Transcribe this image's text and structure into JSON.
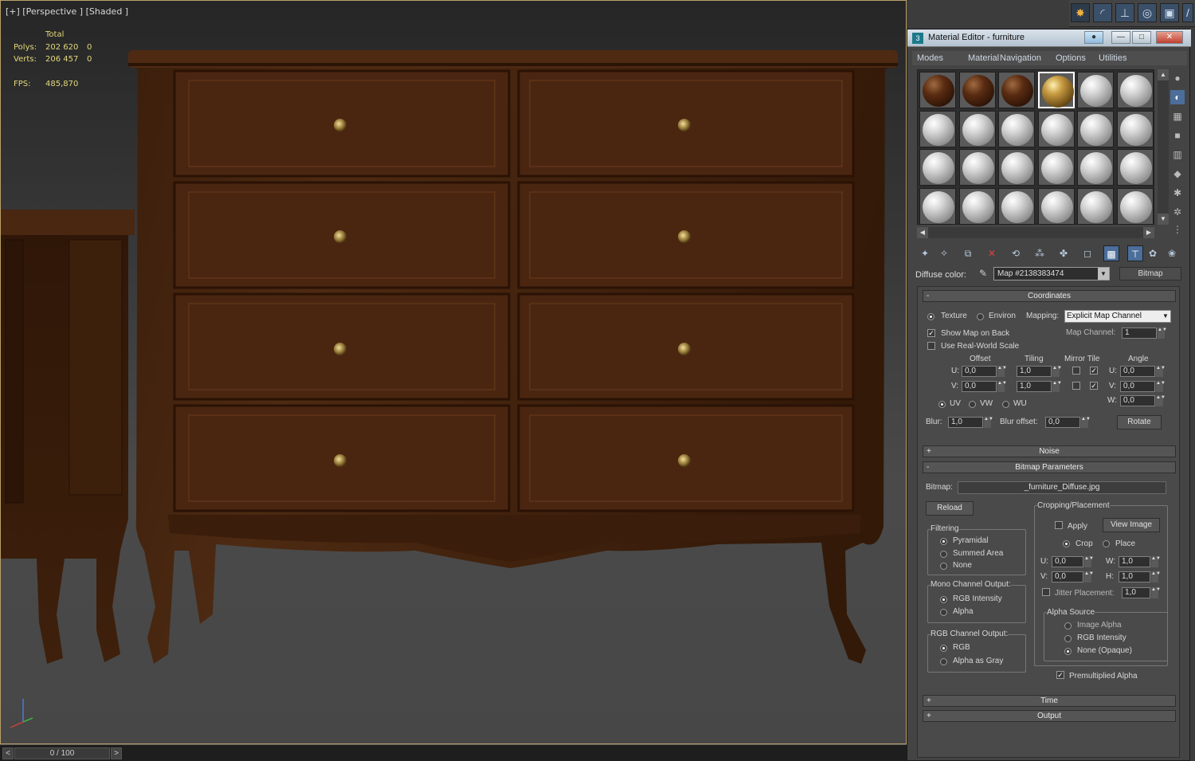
{
  "viewport": {
    "label": "[+] [Perspective ] [Shaded ]",
    "stats": {
      "total_label": "Total",
      "polys_label": "Polys:",
      "polys_value": "202 620",
      "polys_sel": "0",
      "verts_label": "Verts:",
      "verts_value": "206 457",
      "verts_sel": "0",
      "fps_label": "FPS:",
      "fps_value": "485,870"
    }
  },
  "timeline": {
    "frame": "0 / 100",
    "prev": "<",
    "next": ">"
  },
  "command_tabs": [
    "sun-icon",
    "curve-icon",
    "hierarchy-icon",
    "motion-icon",
    "display-icon",
    "utilities-icon"
  ],
  "material_editor": {
    "title": "Material Editor - furniture",
    "menu": [
      "Modes",
      "Material",
      "Navigation",
      "Options",
      "Utilities"
    ],
    "slots": [
      [
        "wood",
        "wood",
        "wood",
        "gold",
        "grey",
        "grey"
      ],
      [
        "grey",
        "grey",
        "grey",
        "grey",
        "grey",
        "grey"
      ],
      [
        "grey",
        "grey",
        "grey",
        "grey",
        "grey",
        "grey"
      ],
      [
        "grey",
        "grey",
        "grey",
        "grey",
        "grey",
        "grey"
      ]
    ],
    "selected_slot": 3,
    "diffuse": {
      "label": "Diffuse color:",
      "map_name": "Map #2138383474",
      "map_type": "Bitmap"
    },
    "coordinates": {
      "title": "Coordinates",
      "texture": "Texture",
      "environ": "Environ",
      "mapping_label": "Mapping:",
      "mapping_value": "Explicit Map Channel",
      "show_map_on_back": "Show Map on Back",
      "map_channel_label": "Map Channel:",
      "map_channel_value": "1",
      "use_real_world": "Use Real-World Scale",
      "offset": "Offset",
      "tiling": "Tiling",
      "mirror_tile": "Mirror Tile",
      "angle": "Angle",
      "u_label": "U:",
      "v_label": "V:",
      "w_label": "W:",
      "offset_u": "0,0",
      "offset_v": "0,0",
      "tiling_u": "1,0",
      "tiling_v": "1,0",
      "angle_u": "0,0",
      "angle_v": "0,0",
      "angle_w": "0,0",
      "uv": "UV",
      "vw": "VW",
      "wu": "WU",
      "blur_label": "Blur:",
      "blur_value": "1,0",
      "blur_offset_label": "Blur offset:",
      "blur_offset_value": "0,0",
      "rotate": "Rotate"
    },
    "noise": {
      "title": "Noise"
    },
    "bitmap_params": {
      "title": "Bitmap Parameters",
      "bitmap_label": "Bitmap:",
      "bitmap_file": "_furniture_Diffuse.jpg",
      "reload": "Reload",
      "cropping_title": "Cropping/Placement",
      "apply": "Apply",
      "view_image": "View Image",
      "crop": "Crop",
      "place": "Place",
      "u_label": "U:",
      "v_label": "V:",
      "w_label": "W:",
      "h_label": "H:",
      "crop_u": "0,0",
      "crop_v": "0,0",
      "crop_w": "1,0",
      "crop_h": "1,0",
      "jitter": "Jitter Placement:",
      "jitter_value": "1,0",
      "filtering_title": "Filtering",
      "pyramidal": "Pyramidal",
      "summed_area": "Summed Area",
      "none": "None",
      "mono_title": "Mono Channel Output:",
      "rgb_intensity": "RGB Intensity",
      "alpha": "Alpha",
      "rgb_out_title": "RGB Channel Output:",
      "rgb": "RGB",
      "alpha_as_gray": "Alpha as Gray",
      "alpha_source_title": "Alpha Source",
      "image_alpha": "Image Alpha",
      "rgb_intensity2": "RGB Intensity",
      "none_opaque": "None (Opaque)",
      "premultiplied": "Premultiplied Alpha"
    },
    "time": {
      "title": "Time"
    },
    "output": {
      "title": "Output"
    }
  }
}
